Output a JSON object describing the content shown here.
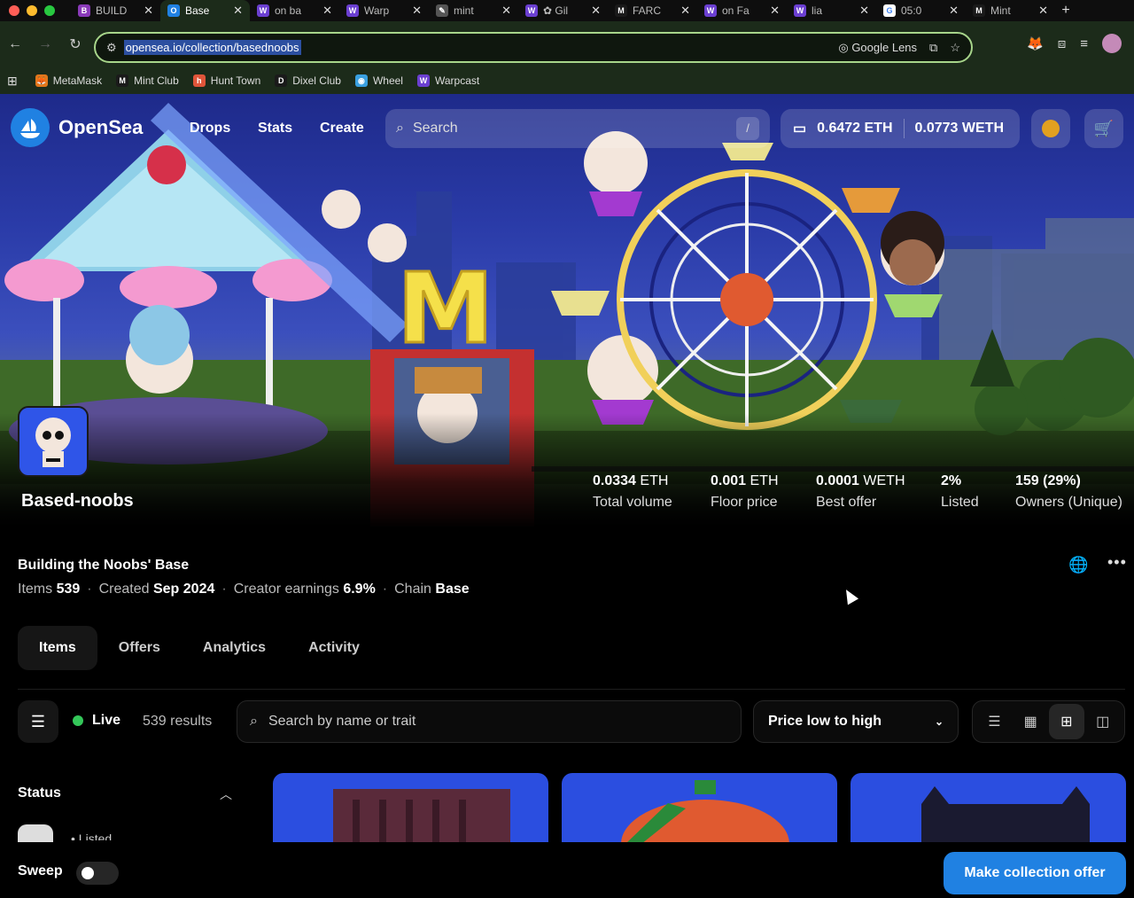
{
  "browser": {
    "tabs": [
      {
        "title": "BUILD",
        "favicon": "B",
        "color": "#8a3ab9"
      },
      {
        "title": "Base",
        "favicon": "O",
        "color": "#2081e2",
        "active": true
      },
      {
        "title": "on ba",
        "favicon": "W",
        "color": "#6b3fd1"
      },
      {
        "title": "Warp",
        "favicon": "W",
        "color": "#6b3fd1"
      },
      {
        "title": "mint",
        "favicon": "✎",
        "color": "#555"
      },
      {
        "title": "✿ Gil",
        "favicon": "W",
        "color": "#6b3fd1"
      },
      {
        "title": "FARC",
        "favicon": "M",
        "color": "#1a1a1a"
      },
      {
        "title": "on Fa",
        "favicon": "W",
        "color": "#6b3fd1"
      },
      {
        "title": "lia",
        "favicon": "W",
        "color": "#6b3fd1"
      },
      {
        "title": "05:0",
        "favicon": "G",
        "color": "#fff"
      },
      {
        "title": "Mint",
        "favicon": "M",
        "color": "#1a1a1a"
      }
    ],
    "url": "opensea.io/collection/basednoobs",
    "google_lens": "Google Lens",
    "bookmarks": [
      {
        "label": "MetaMask",
        "color": "#e2761b",
        "icon": "🦊"
      },
      {
        "label": "Mint Club",
        "color": "#1a1a1a",
        "icon": "M"
      },
      {
        "label": "Hunt Town",
        "color": "#e0553a",
        "icon": "h"
      },
      {
        "label": "Dixel Club",
        "color": "#1a1a1a",
        "icon": "D"
      },
      {
        "label": "Wheel",
        "color": "#3aa0e0",
        "icon": "◉"
      },
      {
        "label": "Warpcast",
        "color": "#6b3fd1",
        "icon": "W"
      }
    ]
  },
  "nav": {
    "brand": "OpenSea",
    "links": [
      "Drops",
      "Stats",
      "Create"
    ],
    "search_placeholder": "Search",
    "search_shortcut": "/",
    "eth_balance": "0.6472 ETH",
    "weth_balance": "0.0773 WETH"
  },
  "collection": {
    "name": "Based-noobs",
    "tagline": "Building the Noobs' Base",
    "meta": {
      "items_label": "Items",
      "items": "539",
      "created_label": "Created",
      "created": "Sep 2024",
      "earnings_label": "Creator earnings",
      "earnings": "6.9%",
      "chain_label": "Chain",
      "chain": "Base"
    },
    "stats": [
      {
        "value": "0.0334",
        "unit": "ETH",
        "label": "Total volume"
      },
      {
        "value": "0.001",
        "unit": "ETH",
        "label": "Floor price"
      },
      {
        "value": "0.0001",
        "unit": "WETH",
        "label": "Best offer"
      },
      {
        "value": "2%",
        "unit": "",
        "label": "Listed"
      },
      {
        "value": "159 (29%)",
        "unit": "",
        "label": "Owners (Unique)"
      }
    ]
  },
  "tabs": [
    "Items",
    "Offers",
    "Analytics",
    "Activity"
  ],
  "toolbar": {
    "live": "Live",
    "results": "539 results",
    "search_placeholder": "Search by name or trait",
    "sort": "Price low to high"
  },
  "sidebar": {
    "status_title": "Status",
    "listed_label": "Listed"
  },
  "footer": {
    "sweep": "Sweep",
    "offer_button": "Make collection offer"
  }
}
